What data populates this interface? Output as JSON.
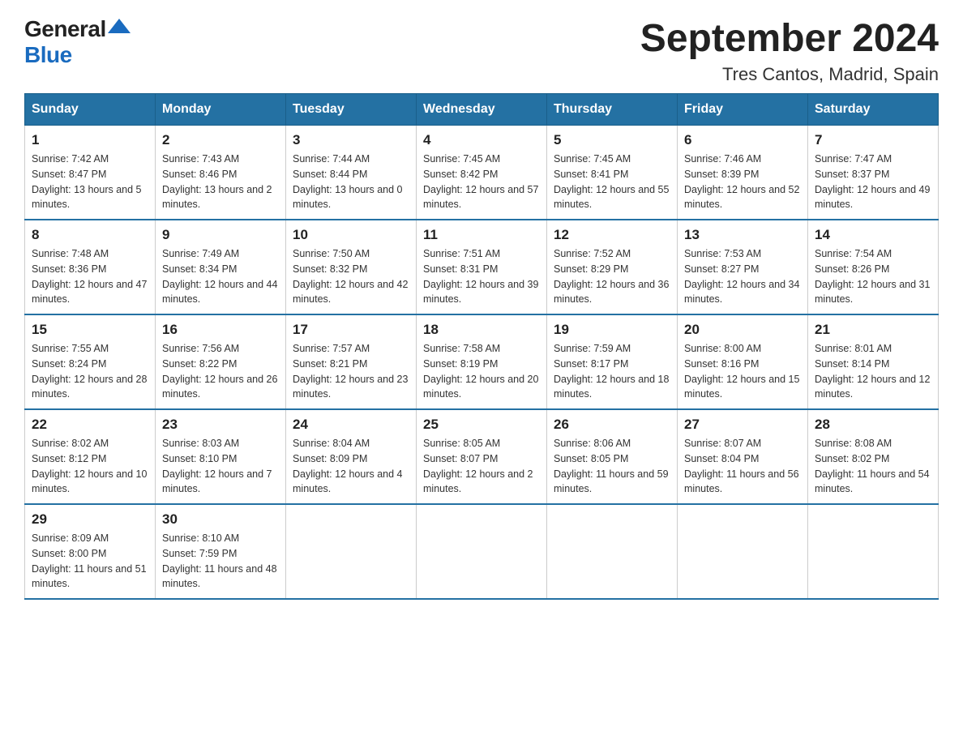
{
  "logo": {
    "general": "General",
    "blue": "Blue"
  },
  "title": "September 2024",
  "location": "Tres Cantos, Madrid, Spain",
  "days_of_week": [
    "Sunday",
    "Monday",
    "Tuesday",
    "Wednesday",
    "Thursday",
    "Friday",
    "Saturday"
  ],
  "weeks": [
    [
      {
        "day": "1",
        "sunrise": "7:42 AM",
        "sunset": "8:47 PM",
        "daylight": "13 hours and 5 minutes."
      },
      {
        "day": "2",
        "sunrise": "7:43 AM",
        "sunset": "8:46 PM",
        "daylight": "13 hours and 2 minutes."
      },
      {
        "day": "3",
        "sunrise": "7:44 AM",
        "sunset": "8:44 PM",
        "daylight": "13 hours and 0 minutes."
      },
      {
        "day": "4",
        "sunrise": "7:45 AM",
        "sunset": "8:42 PM",
        "daylight": "12 hours and 57 minutes."
      },
      {
        "day": "5",
        "sunrise": "7:45 AM",
        "sunset": "8:41 PM",
        "daylight": "12 hours and 55 minutes."
      },
      {
        "day": "6",
        "sunrise": "7:46 AM",
        "sunset": "8:39 PM",
        "daylight": "12 hours and 52 minutes."
      },
      {
        "day": "7",
        "sunrise": "7:47 AM",
        "sunset": "8:37 PM",
        "daylight": "12 hours and 49 minutes."
      }
    ],
    [
      {
        "day": "8",
        "sunrise": "7:48 AM",
        "sunset": "8:36 PM",
        "daylight": "12 hours and 47 minutes."
      },
      {
        "day": "9",
        "sunrise": "7:49 AM",
        "sunset": "8:34 PM",
        "daylight": "12 hours and 44 minutes."
      },
      {
        "day": "10",
        "sunrise": "7:50 AM",
        "sunset": "8:32 PM",
        "daylight": "12 hours and 42 minutes."
      },
      {
        "day": "11",
        "sunrise": "7:51 AM",
        "sunset": "8:31 PM",
        "daylight": "12 hours and 39 minutes."
      },
      {
        "day": "12",
        "sunrise": "7:52 AM",
        "sunset": "8:29 PM",
        "daylight": "12 hours and 36 minutes."
      },
      {
        "day": "13",
        "sunrise": "7:53 AM",
        "sunset": "8:27 PM",
        "daylight": "12 hours and 34 minutes."
      },
      {
        "day": "14",
        "sunrise": "7:54 AM",
        "sunset": "8:26 PM",
        "daylight": "12 hours and 31 minutes."
      }
    ],
    [
      {
        "day": "15",
        "sunrise": "7:55 AM",
        "sunset": "8:24 PM",
        "daylight": "12 hours and 28 minutes."
      },
      {
        "day": "16",
        "sunrise": "7:56 AM",
        "sunset": "8:22 PM",
        "daylight": "12 hours and 26 minutes."
      },
      {
        "day": "17",
        "sunrise": "7:57 AM",
        "sunset": "8:21 PM",
        "daylight": "12 hours and 23 minutes."
      },
      {
        "day": "18",
        "sunrise": "7:58 AM",
        "sunset": "8:19 PM",
        "daylight": "12 hours and 20 minutes."
      },
      {
        "day": "19",
        "sunrise": "7:59 AM",
        "sunset": "8:17 PM",
        "daylight": "12 hours and 18 minutes."
      },
      {
        "day": "20",
        "sunrise": "8:00 AM",
        "sunset": "8:16 PM",
        "daylight": "12 hours and 15 minutes."
      },
      {
        "day": "21",
        "sunrise": "8:01 AM",
        "sunset": "8:14 PM",
        "daylight": "12 hours and 12 minutes."
      }
    ],
    [
      {
        "day": "22",
        "sunrise": "8:02 AM",
        "sunset": "8:12 PM",
        "daylight": "12 hours and 10 minutes."
      },
      {
        "day": "23",
        "sunrise": "8:03 AM",
        "sunset": "8:10 PM",
        "daylight": "12 hours and 7 minutes."
      },
      {
        "day": "24",
        "sunrise": "8:04 AM",
        "sunset": "8:09 PM",
        "daylight": "12 hours and 4 minutes."
      },
      {
        "day": "25",
        "sunrise": "8:05 AM",
        "sunset": "8:07 PM",
        "daylight": "12 hours and 2 minutes."
      },
      {
        "day": "26",
        "sunrise": "8:06 AM",
        "sunset": "8:05 PM",
        "daylight": "11 hours and 59 minutes."
      },
      {
        "day": "27",
        "sunrise": "8:07 AM",
        "sunset": "8:04 PM",
        "daylight": "11 hours and 56 minutes."
      },
      {
        "day": "28",
        "sunrise": "8:08 AM",
        "sunset": "8:02 PM",
        "daylight": "11 hours and 54 minutes."
      }
    ],
    [
      {
        "day": "29",
        "sunrise": "8:09 AM",
        "sunset": "8:00 PM",
        "daylight": "11 hours and 51 minutes."
      },
      {
        "day": "30",
        "sunrise": "8:10 AM",
        "sunset": "7:59 PM",
        "daylight": "11 hours and 48 minutes."
      },
      null,
      null,
      null,
      null,
      null
    ]
  ]
}
